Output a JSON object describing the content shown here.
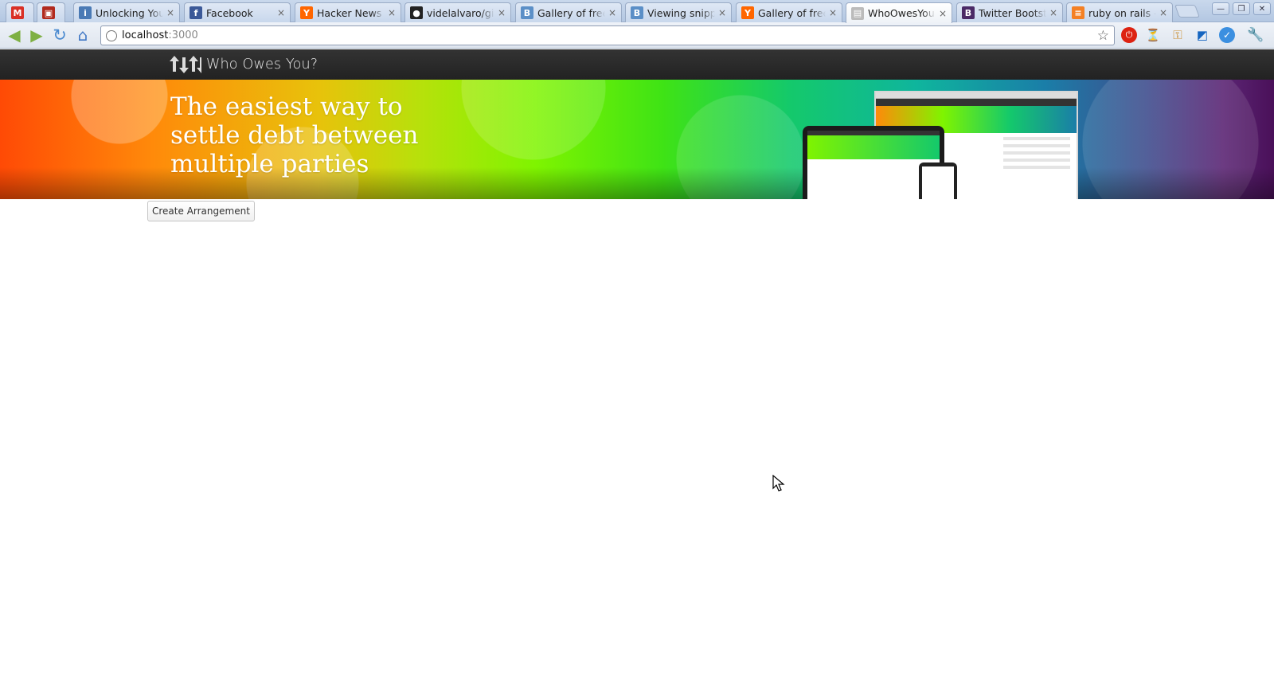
{
  "browser": {
    "tabs": [
      {
        "title": "",
        "favicon": "gmail-icon",
        "color": "#d93025",
        "glyph": "M"
      },
      {
        "title": "",
        "favicon": "bookmark-icon",
        "color": "#b12a1e",
        "glyph": "▣"
      },
      {
        "title": "Unlocking Your",
        "favicon": "info-icon",
        "color": "#4a7ab5",
        "glyph": "i"
      },
      {
        "title": "Facebook",
        "favicon": "facebook-icon",
        "color": "#3b5998",
        "glyph": "f"
      },
      {
        "title": "Hacker News",
        "favicon": "hackernews-icon",
        "color": "#ff6600",
        "glyph": "Y"
      },
      {
        "title": "videlalvaro/gifs",
        "favicon": "github-icon",
        "color": "#222222",
        "glyph": "●"
      },
      {
        "title": "Gallery of free",
        "favicon": "bootstrap-b-icon",
        "color": "#5b8fc7",
        "glyph": "B"
      },
      {
        "title": "Viewing snipp",
        "favicon": "bootstrap-b-icon",
        "color": "#5b8fc7",
        "glyph": "B"
      },
      {
        "title": "Gallery of free",
        "favicon": "hackernews-icon",
        "color": "#ff6600",
        "glyph": "Y"
      },
      {
        "title": "WhoOwesYou",
        "favicon": "page-icon",
        "color": "#bbbbbb",
        "glyph": "▤"
      },
      {
        "title": "Twitter Bootstr",
        "favicon": "bootstrap-icon",
        "color": "#4b2a66",
        "glyph": "B"
      },
      {
        "title": "ruby on rails -",
        "favicon": "stackoverflow-icon",
        "color": "#f48024",
        "glyph": "≡"
      }
    ],
    "address": {
      "host": "localhost",
      "port": ":3000"
    }
  },
  "site": {
    "brand": "Who Owes You?",
    "headline": "The easiest way to settle debt between multiple parties",
    "create_button": "Create Arrangement"
  }
}
